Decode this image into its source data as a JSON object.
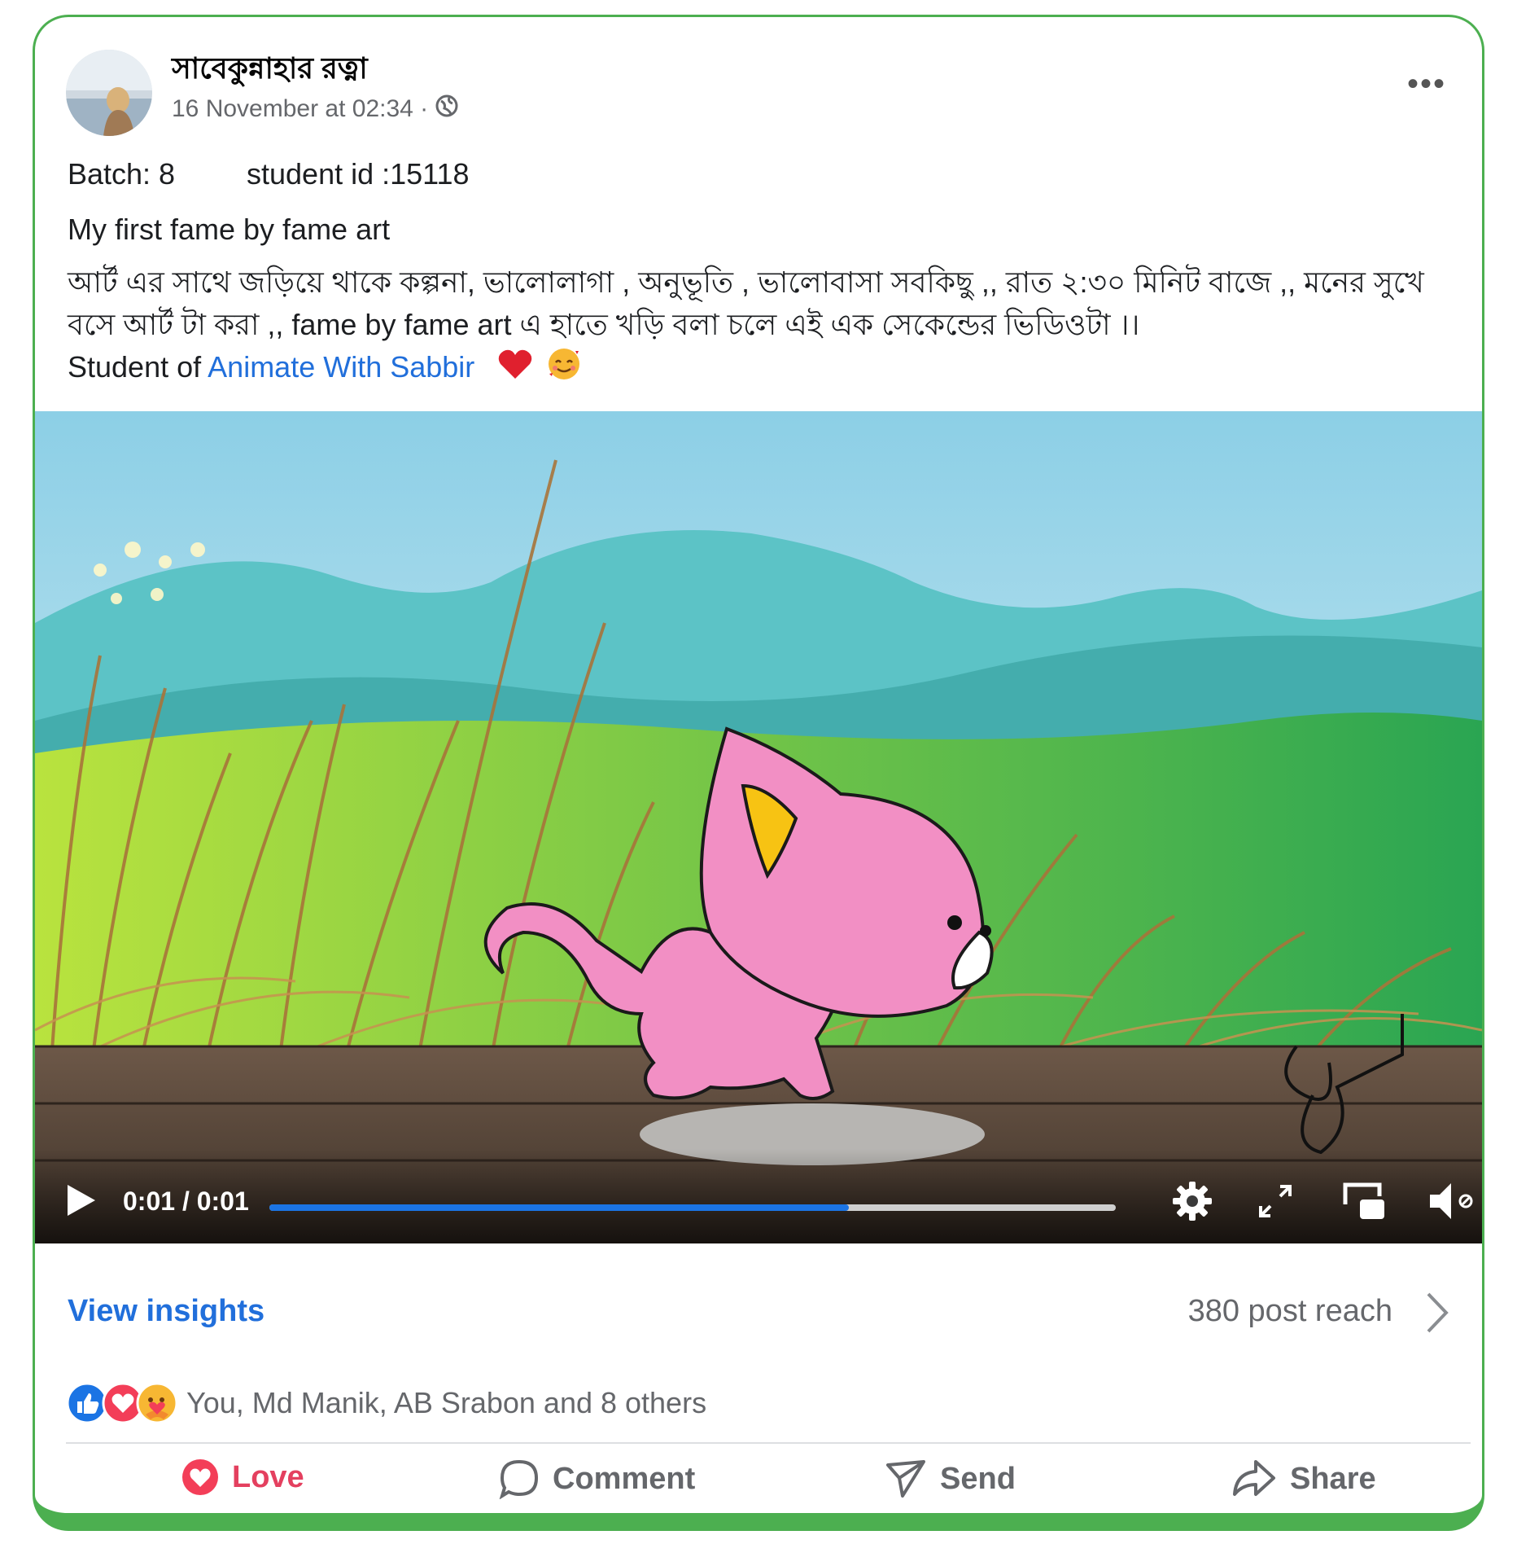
{
  "post": {
    "author": "সাবেকুন্নাহার রত্না",
    "timestamp": "16 November at 02:34 ·",
    "privacy_icon": "globe-icon",
    "more_icon": "more-options-icon",
    "more_label": "•••"
  },
  "text": {
    "batch": "Batch: 8",
    "student_id": "student id :15118",
    "line1": "My first fame by fame art",
    "line2": "আর্ট এর সাথে জড়িয়ে থাকে  কল্পনা, ভালোলাগা , অনুভূতি , ভালোবাসা সবকিছু ,, রাত ২:৩০ মিনিট বাজে ,, মনের সুখে বসে আর্ট টা করা  ,, fame by fame art এ হাতে খড়ি বলা চলে এই এক সেকেন্ডের ভিডিওটা ।।",
    "student_of": "Student of",
    "link_text": "Animate With Sabbir",
    "emojis": [
      "heart-emoji",
      "smiling-face-with-hearts-emoji"
    ]
  },
  "video": {
    "time": "0:01 / 0:01",
    "progress": 0.685,
    "icons": [
      "play-icon",
      "settings-icon",
      "fullscreen-icon",
      "pip-icon",
      "volume-muted-icon"
    ]
  },
  "insights": {
    "label": "View insights",
    "reach": "380 post reach"
  },
  "reactions": {
    "icons": [
      "like-reaction",
      "love-reaction",
      "care-reaction"
    ],
    "text": "You, Md Manik, AB Srabon and 8 others"
  },
  "actions": {
    "love": "Love",
    "comment": "Comment",
    "send": "Send",
    "share": "Share"
  },
  "colors": {
    "border_green": "#4caf50",
    "link_blue": "#216fdb",
    "love_red": "#e4405f",
    "progress_blue": "#1b74e4"
  }
}
